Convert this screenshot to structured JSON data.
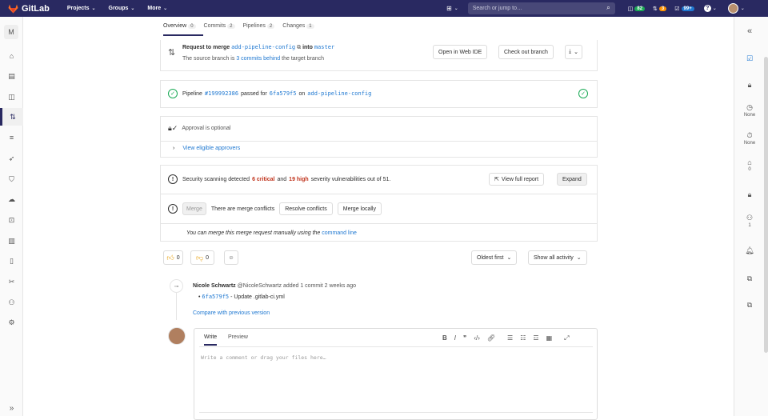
{
  "topbar": {
    "brand": "GitLab",
    "nav": [
      {
        "label": "Projects",
        "chevron": "⌄"
      },
      {
        "label": "Groups",
        "chevron": "⌄"
      },
      {
        "label": "More",
        "chevron": "⌄"
      }
    ],
    "search_placeholder": "Search or jump to…",
    "issues_count": "82",
    "mr_count": "3",
    "todo_count": "99+",
    "colors": {
      "bg": "#292961",
      "green": "#1aaa55",
      "orange": "#fc9403",
      "blue": "#1f78d1"
    }
  },
  "leftbar": {
    "project_initial": "M",
    "items": [
      {
        "icon": "home-icon",
        "glyph": "⌂"
      },
      {
        "icon": "document-icon",
        "glyph": "▤"
      },
      {
        "icon": "issues-icon",
        "glyph": "◫"
      },
      {
        "icon": "merge-request-icon",
        "glyph": "⇅"
      },
      {
        "icon": "list-icon",
        "glyph": "≡"
      },
      {
        "icon": "rocket-icon",
        "glyph": "➶"
      },
      {
        "icon": "shield-icon",
        "glyph": "⛉"
      },
      {
        "icon": "deploy-icon",
        "glyph": "☁"
      },
      {
        "icon": "package-icon",
        "glyph": "⊡"
      },
      {
        "icon": "analytics-icon",
        "glyph": "▥"
      },
      {
        "icon": "wiki-icon",
        "glyph": "▯"
      },
      {
        "icon": "snippets-icon",
        "glyph": "✂"
      },
      {
        "icon": "members-icon",
        "glyph": "⚇"
      },
      {
        "icon": "settings-icon",
        "glyph": "⚙"
      }
    ],
    "collapse": "»"
  },
  "tabs": [
    {
      "label": "Overview",
      "count": "0"
    },
    {
      "label": "Commits",
      "count": "2"
    },
    {
      "label": "Pipelines",
      "count": "2"
    },
    {
      "label": "Changes",
      "count": "1"
    }
  ],
  "request": {
    "prefix": "Request to merge",
    "source_branch": "add-pipeline-config",
    "into": "into",
    "target_branch": "master",
    "behind_prefix": "The source branch is",
    "behind_link": "3 commits behind",
    "behind_suffix": "the target branch",
    "open_ide": "Open in Web IDE",
    "checkout": "Check out branch"
  },
  "pipeline": {
    "label": "Pipeline",
    "id": "#199992386",
    "passed_for": "passed for",
    "commit": "6fa579f5",
    "on": "on",
    "branch": "add-pipeline-config"
  },
  "approval": {
    "text": "Approval is optional",
    "view_link": "View eligible approvers"
  },
  "security": {
    "prefix": "Security scanning detected",
    "critical": "6 critical",
    "and": "and",
    "high": "19 high",
    "suffix": "severity vulnerabilities out of 51.",
    "full_report": "View full report",
    "expand": "Expand"
  },
  "merge": {
    "merge_btn": "Merge",
    "conflicts": "There are merge conflicts",
    "resolve": "Resolve conflicts",
    "locally": "Merge locally",
    "manual_prefix": "You can merge this merge request manually using the",
    "manual_link": "command line"
  },
  "reactions": {
    "thumbs_up": "0",
    "thumbs_down": "0"
  },
  "activity": {
    "sort": "Oldest first",
    "filter": "Show all activity",
    "author": "Nicole Schwartz",
    "handle": "@NicoleSchwartz",
    "action": "added 1 commit 2 weeks ago",
    "commit_sha": "6fa579f5",
    "commit_msg": "- Update .gitlab-ci.yml",
    "compare": "Compare with previous version"
  },
  "editor": {
    "tab_write": "Write",
    "tab_preview": "Preview",
    "placeholder": "Write a comment or drag your files here…"
  },
  "rightbar": {
    "milestone": "None",
    "time": "None",
    "labels": "0",
    "participants": "1"
  }
}
